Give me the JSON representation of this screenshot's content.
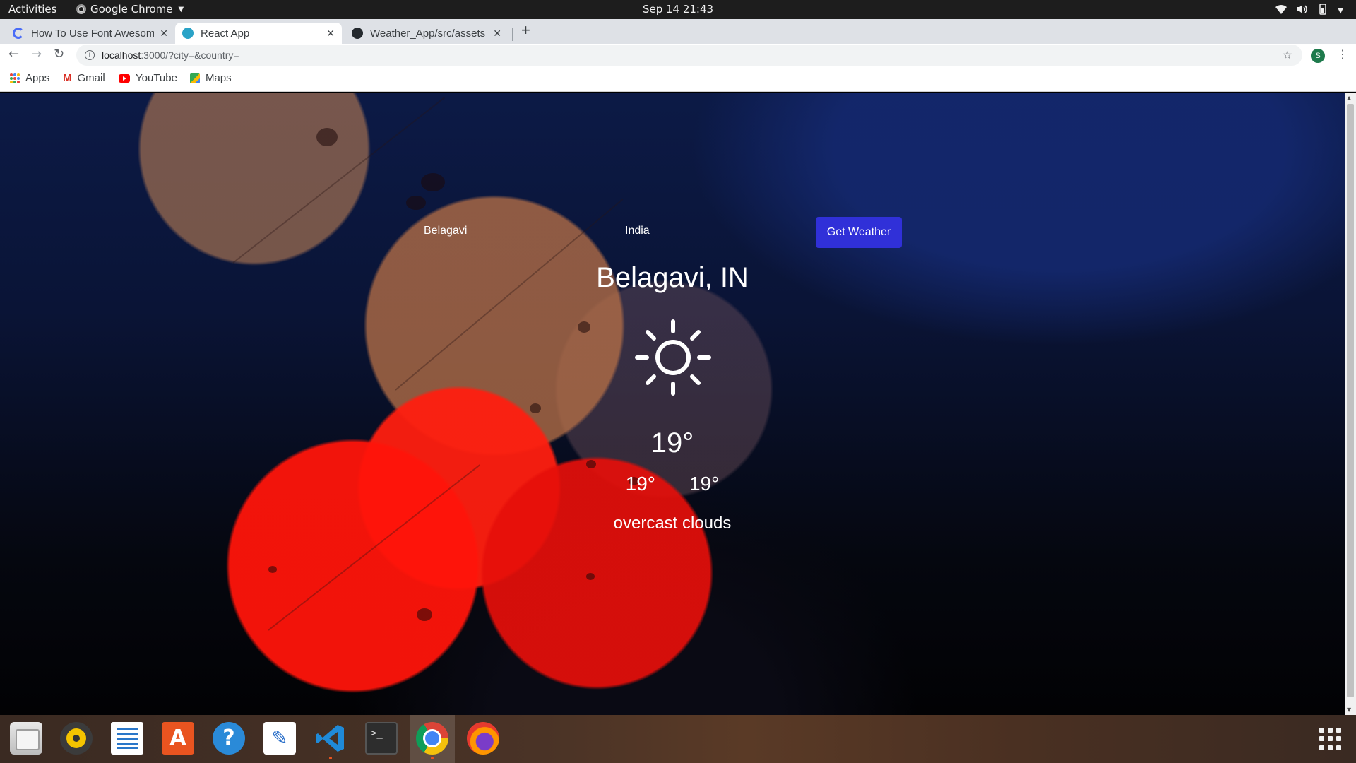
{
  "topbar": {
    "activities": "Activities",
    "app_name": "Google Chrome",
    "clock": "Sep 14  21:43"
  },
  "tabs": [
    {
      "title": "How To Use Font Awesom",
      "favicon": "loader-icon",
      "active": false
    },
    {
      "title": "React App",
      "favicon": "react-icon",
      "active": true
    },
    {
      "title": "Weather_App/src/assets",
      "favicon": "github-icon",
      "active": false
    }
  ],
  "toolbar": {
    "url_host": "localhost",
    "url_path": ":3000/?city=&country="
  },
  "profile_initial": "S",
  "bookmarks": [
    {
      "label": "Apps",
      "icon": "apps-grid-icon"
    },
    {
      "label": "Gmail",
      "icon": "gmail-icon"
    },
    {
      "label": "YouTube",
      "icon": "youtube-icon"
    },
    {
      "label": "Maps",
      "icon": "maps-icon"
    }
  ],
  "form": {
    "city_value": "Belagavi",
    "country_value": "India",
    "submit_label": "Get Weather"
  },
  "weather": {
    "location": "Belagavi, IN",
    "icon": "sun-icon",
    "temp": "19°",
    "temp_min": "19°",
    "temp_max": "19°",
    "description": "overcast clouds"
  },
  "colors": {
    "button": "#3030d8",
    "chrome_tabstrip": "#dee1e6",
    "dock_accent": "#e95420"
  }
}
